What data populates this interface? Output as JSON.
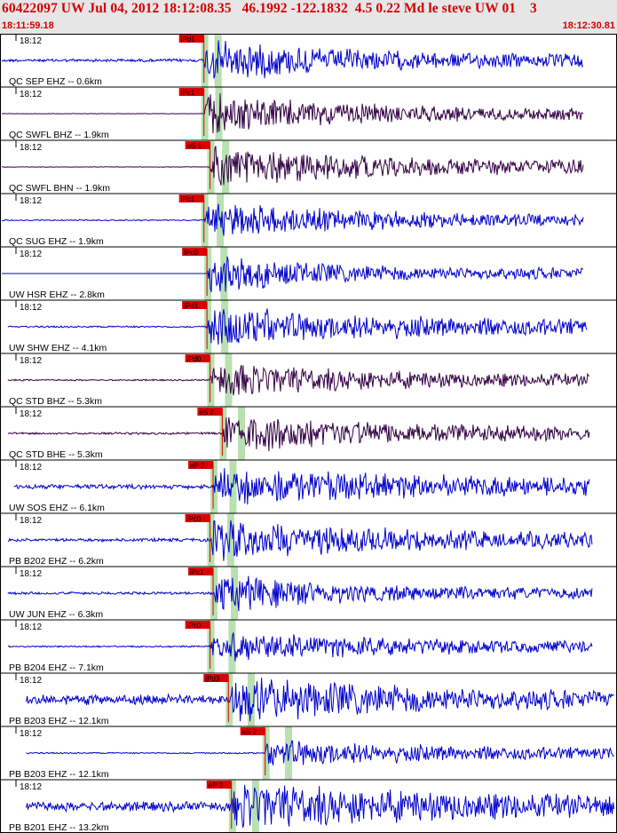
{
  "header": {
    "title": "60422097 UW Jul 04, 2012 18:12:08.35   46.1992 -122.1832  4.5 0.22 Md le steve UW 01    3",
    "start_time": "18:11:59.18",
    "end_time": "18:12:30.81"
  },
  "colors": {
    "header_text": "#d40000",
    "header_bg": "#e6e6e6",
    "trace_blue": "#0000cc",
    "trace_dark": "#330044",
    "pick_label_bg": "#dd0000",
    "pick_window": "#b8e0b0"
  },
  "chart_data": {
    "type": "seismogram",
    "x_range": [
      "18:11:59.18",
      "18:12:30.81"
    ],
    "tick_label": "18:12",
    "traces": [
      {
        "label": "QC SEP EHZ -- 0.6km",
        "pick": "iPd1",
        "color": "blue",
        "start": 0.0,
        "end": 0.95,
        "onset": 0.33,
        "amp": 0.9,
        "pre": 0.06,
        "decay": 0.18
      },
      {
        "label": "QC SWFL BHZ -- 1.9km",
        "pick": "iPc1",
        "color": "dark",
        "start": 0.0,
        "end": 0.95,
        "onset": 0.33,
        "amp": 0.8,
        "pre": 0.01,
        "decay": 0.2
      },
      {
        "label": "QC SWFL BHN -- 1.9km",
        "pick": "eS 1",
        "color": "dark",
        "start": 0.0,
        "end": 0.95,
        "onset": 0.34,
        "amp": 0.9,
        "pre": 0.01,
        "decay": 0.2
      },
      {
        "label": "QC SUG EHZ -- 1.9km",
        "pick": "iPc1",
        "color": "blue",
        "start": 0.0,
        "end": 0.95,
        "onset": 0.33,
        "amp": 0.7,
        "pre": 0.03,
        "decay": 0.25
      },
      {
        "label": "UW HSR EHZ -- 2.8km",
        "pick": "iPc0",
        "color": "blue",
        "start": 0.0,
        "end": 0.95,
        "onset": 0.335,
        "amp": 0.8,
        "pre": 0.0,
        "decay": 0.15
      },
      {
        "label": "UW SHW EHZ -- 4.1km",
        "pick": "iPd1",
        "color": "blue",
        "start": 0.01,
        "end": 0.955,
        "onset": 0.335,
        "amp": 0.8,
        "pre": 0.04,
        "decay": 0.3
      },
      {
        "label": "QC STD BHZ -- 5.3km",
        "pick": "iPd0",
        "color": "dark",
        "start": 0.01,
        "end": 0.96,
        "onset": 0.34,
        "amp": 0.7,
        "pre": 0.04,
        "decay": 0.25
      },
      {
        "label": "QC STD BHE -- 5.3km",
        "pick": "eS 2",
        "color": "dark",
        "start": 0.01,
        "end": 0.96,
        "onset": 0.36,
        "amp": 0.8,
        "pre": 0.05,
        "decay": 0.25
      },
      {
        "label": "UW SOS EHZ -- 6.1km",
        "pick": "eP 2",
        "color": "blue",
        "start": 0.02,
        "end": 0.96,
        "onset": 0.345,
        "amp": 0.7,
        "pre": 0.12,
        "decay": 0.5
      },
      {
        "label": "PB B202 EHZ -- 6.2km",
        "pick": "iPc0",
        "color": "blue",
        "start": 0.01,
        "end": 0.965,
        "onset": 0.34,
        "amp": 0.75,
        "pre": 0.08,
        "decay": 0.35
      },
      {
        "label": "UW JUN EHZ -- 6.3km",
        "pick": "iPc1",
        "color": "blue",
        "start": 0.01,
        "end": 0.965,
        "onset": 0.345,
        "amp": 0.8,
        "pre": 0.06,
        "decay": 0.15
      },
      {
        "label": "PB B204 EHZ -- 7.1km",
        "pick": "iPc0",
        "color": "blue",
        "start": 0.01,
        "end": 0.965,
        "onset": 0.34,
        "amp": 0.6,
        "pre": 0.05,
        "decay": 0.3
      },
      {
        "label": "PB B203 EHZ -- 12.1km",
        "pick": "iPd3",
        "color": "blue",
        "start": 0.04,
        "end": 1.0,
        "onset": 0.37,
        "amp": 0.9,
        "pre": 0.2,
        "decay": 0.35
      },
      {
        "label": "PB B203 EHZ -- 12.1km",
        "pick": "eS 2",
        "color": "blue",
        "start": 0.04,
        "end": 1.0,
        "onset": 0.43,
        "amp": 0.6,
        "pre": 0.04,
        "decay": 0.25
      },
      {
        "label": "PB B201 EHZ -- 13.2km",
        "pick": "eP 2",
        "color": "blue",
        "start": 0.04,
        "end": 1.0,
        "onset": 0.375,
        "amp": 0.9,
        "pre": 0.2,
        "decay": 0.45
      }
    ]
  }
}
